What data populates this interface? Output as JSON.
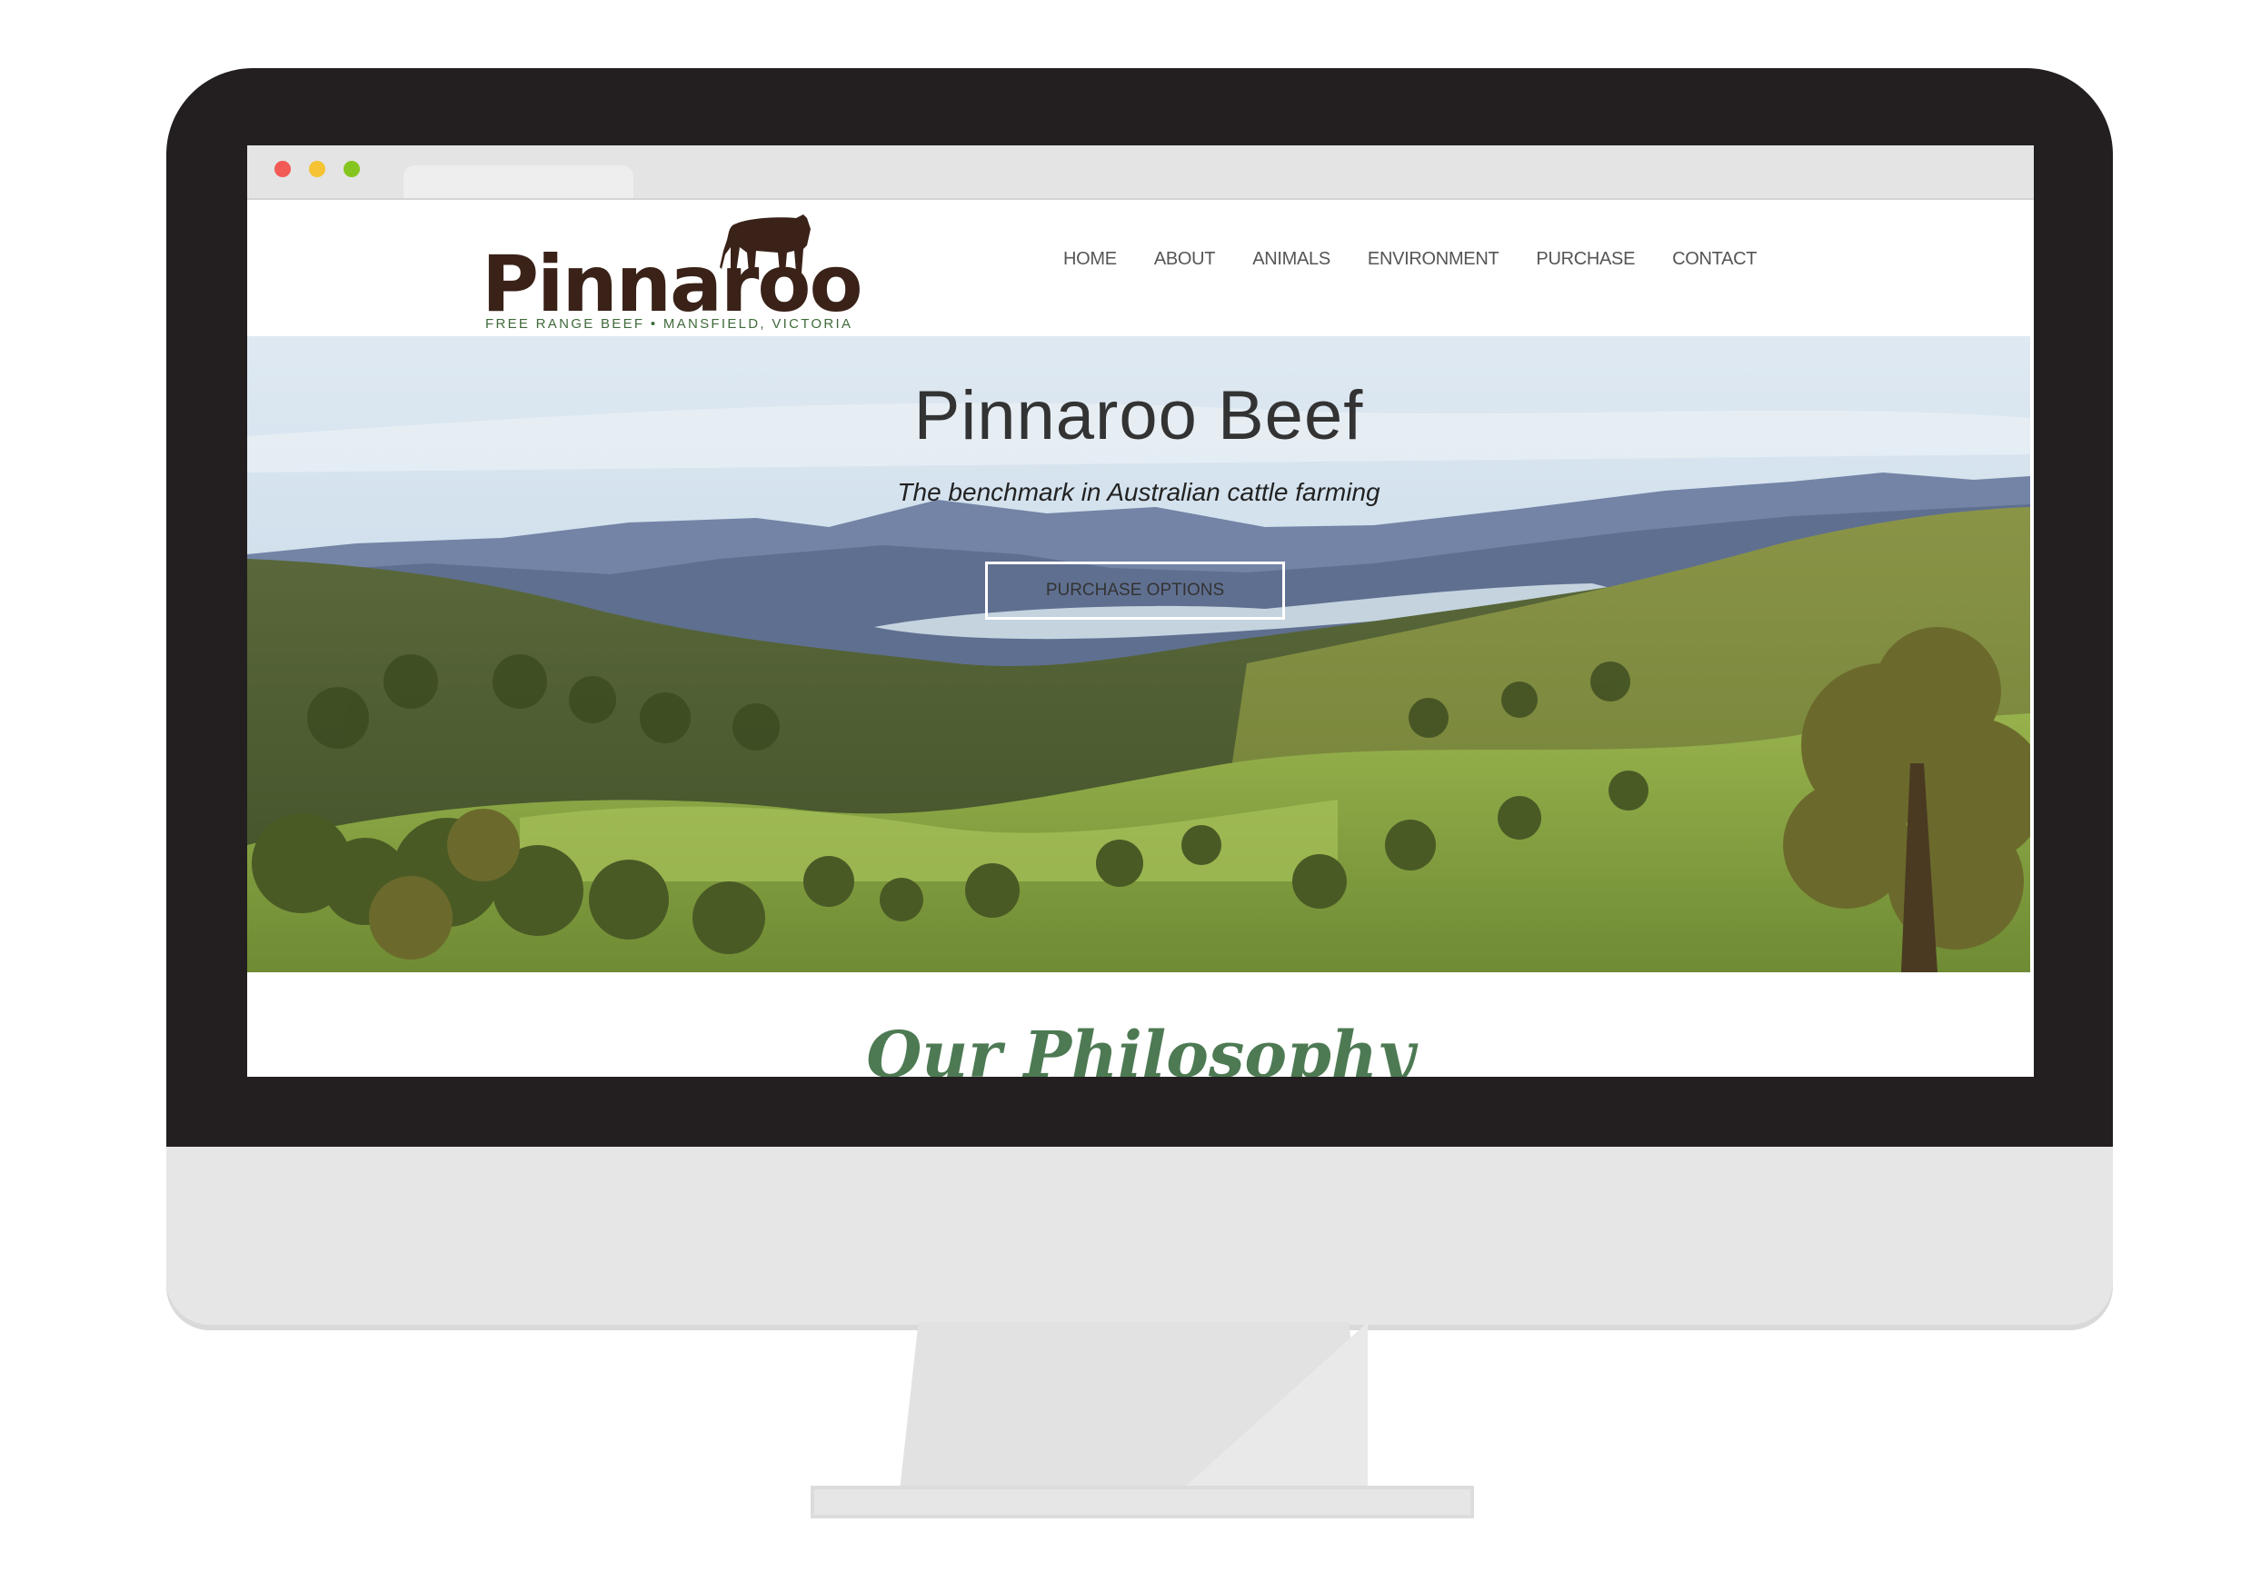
{
  "browser": {
    "window_controls": [
      "close",
      "minimize",
      "maximize"
    ]
  },
  "site": {
    "logo": {
      "wordmark": "Pinnaroo",
      "tagline": "FREE RANGE BEEF • MANSFIELD, VICTORIA",
      "icon": "cow-icon"
    },
    "nav": [
      "HOME",
      "ABOUT",
      "ANIMALS",
      "ENVIRONMENT",
      "PURCHASE",
      "CONTACT"
    ]
  },
  "hero": {
    "title": "Pinnaroo Beef",
    "subtitle": "The benchmark in Australian cattle farming",
    "button_label": "PURCHASE OPTIONS"
  },
  "section": {
    "heading": "Our Philosophy"
  },
  "colors": {
    "logo_brown": "#3a2218",
    "tagline_green": "#3f6a3a",
    "heading_green": "#4d7a53",
    "bezel": "#231f20"
  }
}
